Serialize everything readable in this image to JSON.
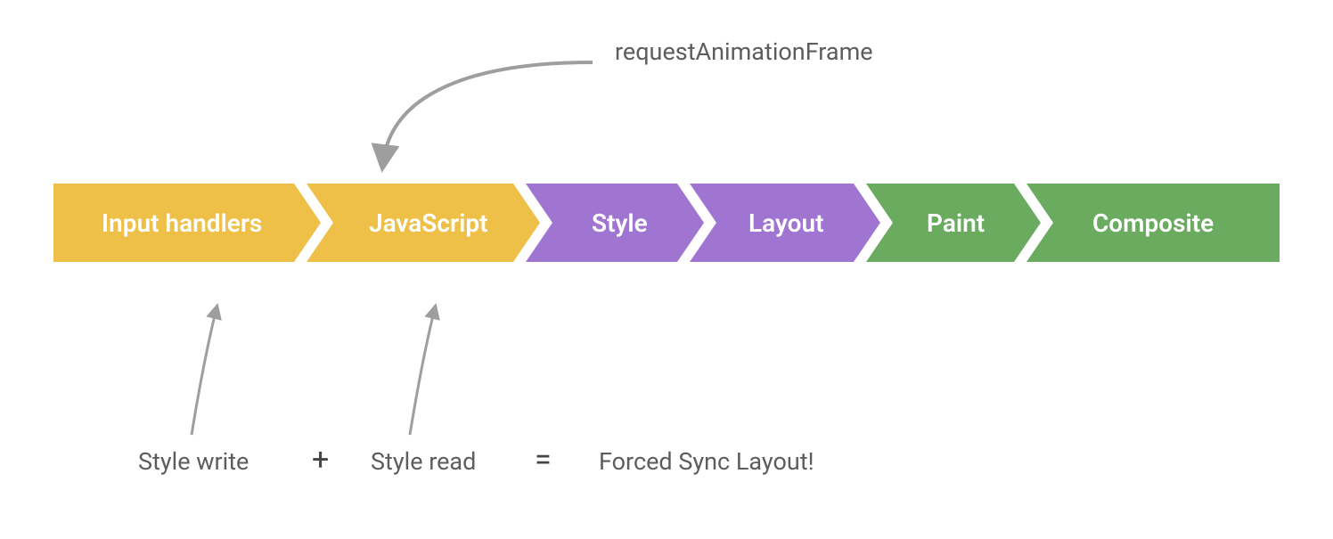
{
  "diagram": {
    "top_annotation": "requestAnimationFrame",
    "stages": [
      {
        "label": "Input handlers",
        "color": "#EEC048"
      },
      {
        "label": "JavaScript",
        "color": "#EEC048"
      },
      {
        "label": "Style",
        "color": "#A074D1"
      },
      {
        "label": "Layout",
        "color": "#A074D1"
      },
      {
        "label": "Paint",
        "color": "#6AAB5F"
      },
      {
        "label": "Composite",
        "color": "#6AAB5F"
      }
    ],
    "bottom": {
      "left_label": "Style write",
      "op1": "+",
      "mid_label": "Style read",
      "op2": "=",
      "result_label": "Forced Sync Layout!"
    },
    "colors": {
      "arrow": "#9E9E9E",
      "text": "#5d5d5d"
    }
  }
}
